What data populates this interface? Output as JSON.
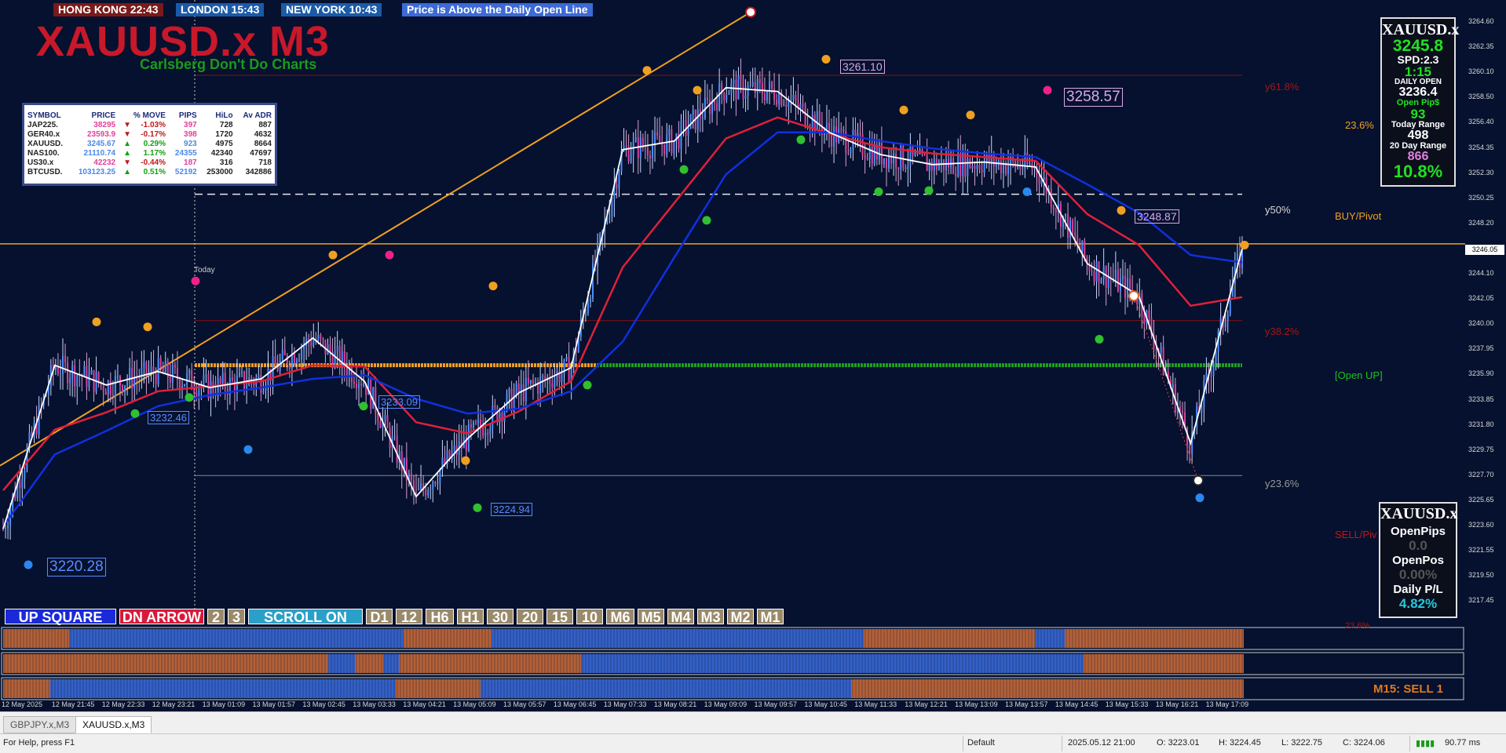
{
  "clocks": {
    "hk": "HONG KONG 22:43",
    "london": "LONDON  15:43",
    "ny": "NEW YORK  10:43",
    "message": "Price is Above the Daily Open Line"
  },
  "title": "XAUUSD.x M3",
  "subtitle": "Carlsberg Don't Do Charts",
  "symbol_table": {
    "headers": [
      "SYMBOL",
      "PRICE",
      "% MOVE",
      "PIPS",
      "HiLo",
      "Av ADR"
    ],
    "rows": [
      {
        "symbol": "JAP225.",
        "price": "38295",
        "dir": "▼",
        "move": "-1.03%",
        "pips": "397",
        "hilo": "728",
        "adr": "887",
        "trend": "down"
      },
      {
        "symbol": "GER40.x",
        "price": "23593.9",
        "dir": "▼",
        "move": "-0.17%",
        "pips": "398",
        "hilo": "1720",
        "adr": "4632",
        "trend": "down"
      },
      {
        "symbol": "XAUUSD.",
        "price": "3245.67",
        "dir": "▲",
        "move": "0.29%",
        "pips": "923",
        "hilo": "4975",
        "adr": "8664",
        "trend": "up"
      },
      {
        "symbol": "NAS100.",
        "price": "21110.74",
        "dir": "▲",
        "move": "1.17%",
        "pips": "24355",
        "hilo": "42340",
        "adr": "47697",
        "trend": "up"
      },
      {
        "symbol": "US30.x",
        "price": "42232",
        "dir": "▼",
        "move": "-0.44%",
        "pips": "187",
        "hilo": "316",
        "adr": "718",
        "trend": "down"
      },
      {
        "symbol": "BTCUSD.",
        "price": "103123.25",
        "dir": "▲",
        "move": "0.51%",
        "pips": "52192",
        "hilo": "253000",
        "adr": "342886",
        "trend": "up"
      }
    ]
  },
  "info_panel": {
    "symbol": "XAUUSD.x",
    "price": "3245.8",
    "spread": "SPD:2.3",
    "timer": "1:15",
    "daily_open_label": "DAILY OPEN",
    "daily_open": "3236.4",
    "open_pips_label": "Open Pip$",
    "open_pips": "93",
    "today_range_label": "Today Range",
    "today_range": "498",
    "day20_range_label": "20 Day Range",
    "day20_range": "866",
    "percent": "10.8%"
  },
  "pl_panel": {
    "symbol": "XAUUSD.x",
    "open_pips_label": "OpenPips",
    "open_pips": "0.0",
    "open_pos_label": "OpenPos",
    "open_pos": "0.00%",
    "daily_pl_label": "Daily P/L",
    "daily_pl": "4.82%"
  },
  "price_axis": [
    "3264.60",
    "3262.35",
    "3260.10",
    "3258.50",
    "3256.40",
    "3254.35",
    "3252.30",
    "3250.25",
    "3248.20",
    "3246.05",
    "3244.10",
    "3242.05",
    "3240.00",
    "3237.95",
    "3235.90",
    "3233.85",
    "3231.80",
    "3229.75",
    "3227.70",
    "3225.65",
    "3223.60",
    "3221.55",
    "3219.50",
    "3217.45"
  ],
  "current_price_tag": "3246.05",
  "fib_labels": {
    "y618": "y61.8%",
    "y50": "y50%",
    "y382": "y38.2%",
    "y236": "y23.6%",
    "r236": "23.6%",
    "buy_pivot": "BUY/Pivot",
    "open_up": "[Open UP]",
    "sell_pivot": "SELL/Piv",
    "bottom_236": "23.6%"
  },
  "price_labels": {
    "p1": "3220.28",
    "p2": "3232.46",
    "p3": "3233.09",
    "p4": "3224.94",
    "p5": "3261.10",
    "p6": "3258.57",
    "p7": "3248.87"
  },
  "today_label": "Today",
  "buttons": [
    {
      "label": "UP SQUARE",
      "bg": "#1a2ad8"
    },
    {
      "label": "DN ARROW",
      "bg": "#d81a3a"
    },
    {
      "label": "2",
      "bg": "#9a8a6a"
    },
    {
      "label": "3",
      "bg": "#9a8a6a"
    },
    {
      "label": "SCROLL ON",
      "bg": "#2aa0c8"
    },
    {
      "label": "D1",
      "bg": "#9a8a6a"
    },
    {
      "label": "12",
      "bg": "#9a8a6a"
    },
    {
      "label": "H6",
      "bg": "#9a8a6a"
    },
    {
      "label": "H1",
      "bg": "#9a8a6a"
    },
    {
      "label": "30",
      "bg": "#9a8a6a"
    },
    {
      "label": "20",
      "bg": "#9a8a6a"
    },
    {
      "label": "15",
      "bg": "#9a8a6a"
    },
    {
      "label": "10",
      "bg": "#9a8a6a"
    },
    {
      "label": "M6",
      "bg": "#9a8a6a"
    },
    {
      "label": "M5",
      "bg": "#9a8a6a"
    },
    {
      "label": "M4",
      "bg": "#9a8a6a"
    },
    {
      "label": "M3",
      "bg": "#9a8a6a"
    },
    {
      "label": "M2",
      "bg": "#9a8a6a"
    },
    {
      "label": "M1",
      "bg": "#9a8a6a"
    }
  ],
  "signal_text": "M15: SELL 1",
  "time_axis": [
    "12 May 2025",
    "12 May 21:45",
    "12 May 22:33",
    "12 May 23:21",
    "13 May 01:09",
    "13 May 01:57",
    "13 May 02:45",
    "13 May 03:33",
    "13 May 04:21",
    "13 May 05:09",
    "13 May 05:57",
    "13 May 06:45",
    "13 May 07:33",
    "13 May 08:21",
    "13 May 09:09",
    "13 May 09:57",
    "13 May 10:45",
    "13 May 11:33",
    "13 May 12:21",
    "13 May 13:09",
    "13 May 13:57",
    "13 May 14:45",
    "13 May 15:33",
    "13 May 16:21",
    "13 May 17:09"
  ],
  "tabs": [
    "GBPJPY.x,M3",
    "XAUUSD.x,M3"
  ],
  "status": {
    "help": "For Help, press F1",
    "profile": "Default",
    "bar_time": "2025.05.12 21:00",
    "open": "O: 3223.01",
    "high": "H: 3224.45",
    "low": "L: 3222.75",
    "close": "C: 3224.06",
    "ping": "90.77 ms"
  },
  "colors": {
    "chart_bg": "#05112e",
    "bull": "#4a90ff",
    "bear": "#e0409a",
    "ma_red": "#e0203a",
    "ma_blue": "#1030e0",
    "open_line": "#20a020",
    "trend_line": "#f0a020"
  },
  "chart_data": {
    "type": "line",
    "title": "XAUUSD.x M3",
    "xlabel": "",
    "ylabel": "",
    "ylim": [
      3216.5,
      3265.5
    ],
    "x": [
      "12 May 2025",
      "12 May 21:45",
      "12 May 22:33",
      "12 May 23:21",
      "13 May 01:09",
      "13 May 01:57",
      "13 May 02:45",
      "13 May 03:33",
      "13 May 04:21",
      "13 May 05:09",
      "13 May 05:57",
      "13 May 06:45",
      "13 May 07:33",
      "13 May 08:21",
      "13 May 09:09",
      "13 May 09:57",
      "13 May 10:45",
      "13 May 11:33",
      "13 May 12:21",
      "13 May 13:09",
      "13 May 13:57",
      "13 May 14:45",
      "13 May 15:33",
      "13 May 16:21",
      "13 May 17:09"
    ],
    "series": [
      {
        "values": [
          3223.2,
          3236.4,
          3234.8,
          3235.9,
          3234.6,
          3235.3,
          3238.6,
          3235.1,
          3225.8,
          3230.5,
          3234.2,
          3236.2,
          3253.8,
          3254.5,
          3258.8,
          3258.5,
          3255.2,
          3253.4,
          3252.6,
          3252.8,
          3252.4,
          3244.6,
          3242.0,
          3230.1,
          3245.8
        ]
      },
      {
        "values": [
          3226.3,
          3231.2,
          3232.6,
          3234.3,
          3234.7,
          3235.1,
          3236.4,
          3236.3,
          3231.8,
          3230.9,
          3232.7,
          3235.1,
          3244.3,
          3249.5,
          3254.7,
          3256.4,
          3255.1,
          3254.0,
          3253.5,
          3253.2,
          3252.9,
          3248.6,
          3246.1,
          3241.2,
          3241.9
        ]
      },
      {
        "values": [
          3223.4,
          3229.2,
          3231.1,
          3233.1,
          3234.0,
          3234.6,
          3235.3,
          3235.6,
          3233.7,
          3232.5,
          3232.9,
          3234.3,
          3238.3,
          3245.1,
          3251.8,
          3255.2,
          3255.2,
          3254.5,
          3253.9,
          3253.5,
          3253.2,
          3251.0,
          3248.7,
          3245.3,
          3244.7
        ]
      }
    ],
    "hlines": {
      "y61_8": 3259.8,
      "y50": 3250.2,
      "buy_pivot": 3246.2,
      "y38_2": 3240.0,
      "daily_open": 3236.4,
      "y23_6": 3227.5
    },
    "current_price": 3246.05
  }
}
